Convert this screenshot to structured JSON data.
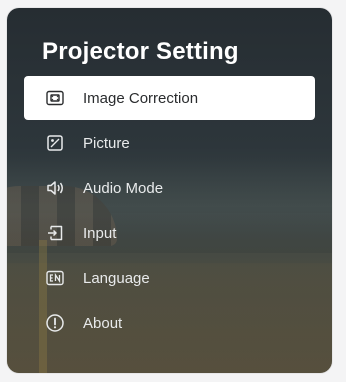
{
  "page": {
    "title": "Projector Setting"
  },
  "menu": {
    "selected_index": 0,
    "items": [
      {
        "label": "Image Correction",
        "icon": "image-correction-icon"
      },
      {
        "label": "Picture",
        "icon": "picture-icon"
      },
      {
        "label": "Audio Mode",
        "icon": "speaker-icon"
      },
      {
        "label": "Input",
        "icon": "input-icon"
      },
      {
        "label": "Language",
        "icon": "language-en-icon"
      },
      {
        "label": "About",
        "icon": "info-icon"
      }
    ]
  },
  "colors": {
    "selected_bg": "#ffffff",
    "text": "#e8eaeb",
    "selected_text": "#2a2c2e"
  }
}
